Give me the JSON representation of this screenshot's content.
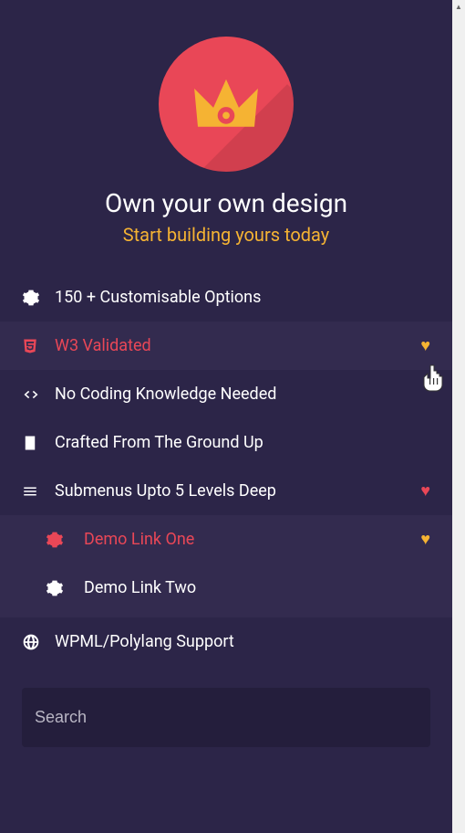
{
  "hero": {
    "title": "Own your own design",
    "subtitle": "Start building yours today"
  },
  "menu": [
    {
      "icon": "gears",
      "label": "150 + Customisable Options"
    },
    {
      "icon": "css3",
      "label": "W3 Validated",
      "heart": "yellow",
      "active": true
    },
    {
      "icon": "code",
      "label": "No Coding Knowledge Needed"
    },
    {
      "icon": "building",
      "label": "Crafted From The Ground Up"
    },
    {
      "icon": "bars",
      "label": "Submenus Upto 5 Levels Deep",
      "heart": "red"
    }
  ],
  "submenu": [
    {
      "icon": "gears",
      "label": "Demo Link One",
      "heart": "yellow",
      "active": true
    },
    {
      "icon": "gears",
      "label": "Demo Link Two"
    }
  ],
  "menu2": [
    {
      "icon": "globe",
      "label": "WPML/Polylang Support"
    }
  ],
  "search": {
    "placeholder": "Search"
  }
}
